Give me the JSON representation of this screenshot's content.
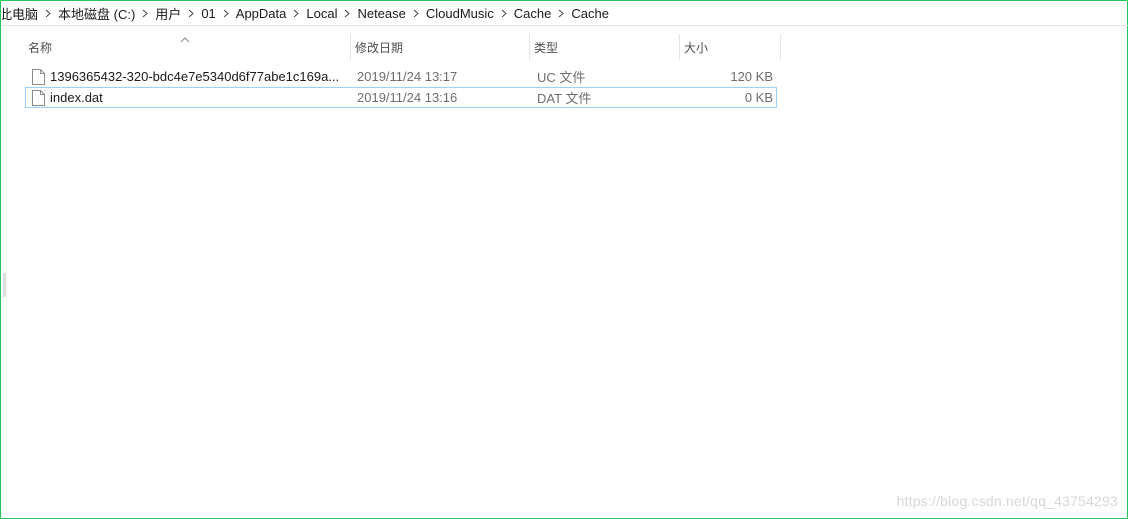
{
  "breadcrumb": [
    "此电脑",
    "本地磁盘 (C:)",
    "用户",
    "01",
    "AppData",
    "Local",
    "Netease",
    "CloudMusic",
    "Cache",
    "Cache"
  ],
  "columns": {
    "name": "名称",
    "modified": "修改日期",
    "type": "类型",
    "size": "大小"
  },
  "files": [
    {
      "name": "1396365432-320-bdc4e7e5340d6f77abe1c169a...",
      "modified": "2019/11/24 13:17",
      "type": "UC 文件",
      "size": "120 KB"
    },
    {
      "name": "index.dat",
      "modified": "2019/11/24 13:16",
      "type": "DAT 文件",
      "size": "0 KB"
    }
  ],
  "watermark": "https://blog.csdn.net/qq_43754293",
  "colors": {
    "frame": "#22c55e",
    "focus": "#99d1ff"
  },
  "icons": {
    "separator": "chevron-right-icon",
    "file": "file-icon",
    "sort": "sort-ascending-icon"
  }
}
